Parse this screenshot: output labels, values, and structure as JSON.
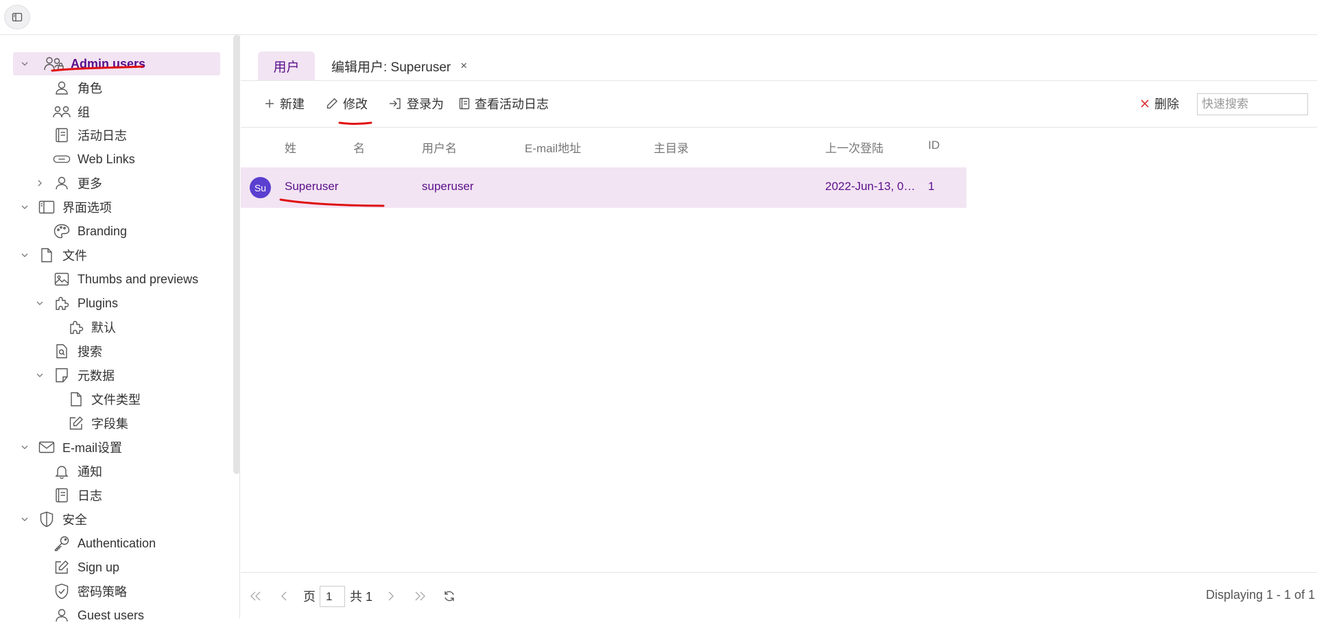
{
  "topbar": {
    "toggle_icon": "sidebar-toggle-icon"
  },
  "sidebar": {
    "items": [
      {
        "label": "Admin users",
        "icon": "admin-users-icon",
        "level": 0,
        "expanded": true,
        "selected": true
      },
      {
        "label": "角色",
        "icon": "role-icon",
        "level": 1
      },
      {
        "label": "组",
        "icon": "group-icon",
        "level": 1
      },
      {
        "label": "活动日志",
        "icon": "log-icon",
        "level": 1
      },
      {
        "label": "Web Links",
        "icon": "link-icon",
        "level": 1
      },
      {
        "label": "更多",
        "icon": "user-icon",
        "level": 1,
        "expanded": false
      },
      {
        "label": "界面选项",
        "icon": "layout-icon",
        "level": 0,
        "expanded": true
      },
      {
        "label": "Branding",
        "icon": "palette-icon",
        "level": 1
      },
      {
        "label": "文件",
        "icon": "file-icon",
        "level": 0,
        "expanded": true
      },
      {
        "label": "Thumbs and previews",
        "icon": "image-icon",
        "level": 1
      },
      {
        "label": "Plugins",
        "icon": "puzzle-icon",
        "level": 1,
        "expanded": true
      },
      {
        "label": "默认",
        "icon": "puzzle-icon",
        "level": 2
      },
      {
        "label": "搜索",
        "icon": "file-search-icon",
        "level": 1
      },
      {
        "label": "元数据",
        "icon": "note-icon",
        "level": 1,
        "expanded": true
      },
      {
        "label": "文件类型",
        "icon": "file-icon",
        "level": 2
      },
      {
        "label": "字段集",
        "icon": "edit-icon",
        "level": 2
      },
      {
        "label": "E-mail设置",
        "icon": "mail-icon",
        "level": 0,
        "expanded": true
      },
      {
        "label": "通知",
        "icon": "bell-icon",
        "level": 1
      },
      {
        "label": "日志",
        "icon": "log-icon",
        "level": 1
      },
      {
        "label": "安全",
        "icon": "shield-icon",
        "level": 0,
        "expanded": true
      },
      {
        "label": "Authentication",
        "icon": "key-icon",
        "level": 1
      },
      {
        "label": "Sign up",
        "icon": "edit-icon",
        "level": 1
      },
      {
        "label": "密码策略",
        "icon": "shield-check-icon",
        "level": 1
      },
      {
        "label": "Guest users",
        "icon": "user-icon",
        "level": 1
      }
    ]
  },
  "tabs": {
    "users": "用户",
    "edit": "编辑用户: Superuser",
    "close": "×"
  },
  "toolbar": {
    "new": "新建",
    "edit": "修改",
    "login_as": "登录为",
    "view_log": "查看活动日志",
    "delete": "删除",
    "search_placeholder": "快速搜索"
  },
  "table": {
    "columns": [
      "姓",
      "名",
      "用户名",
      "E-mail地址",
      "主目录",
      "上一次登陆",
      "ID"
    ],
    "rows": [
      {
        "avatar": "Su",
        "last_name": "Superuser",
        "first_name": "",
        "username": "superuser",
        "email": "",
        "home": "",
        "last_login": "2022-Jun-13, 0…",
        "id": "1"
      }
    ]
  },
  "pager": {
    "page_label": "页",
    "page_value": "1",
    "total_label": "共 1",
    "display": "Displaying 1 - 1 of 1"
  },
  "colors": {
    "accent": "#5b0f8a",
    "selected_bg": "#f2e4f3",
    "avatar": "#5a3fd0",
    "annotation": "#e01010"
  }
}
